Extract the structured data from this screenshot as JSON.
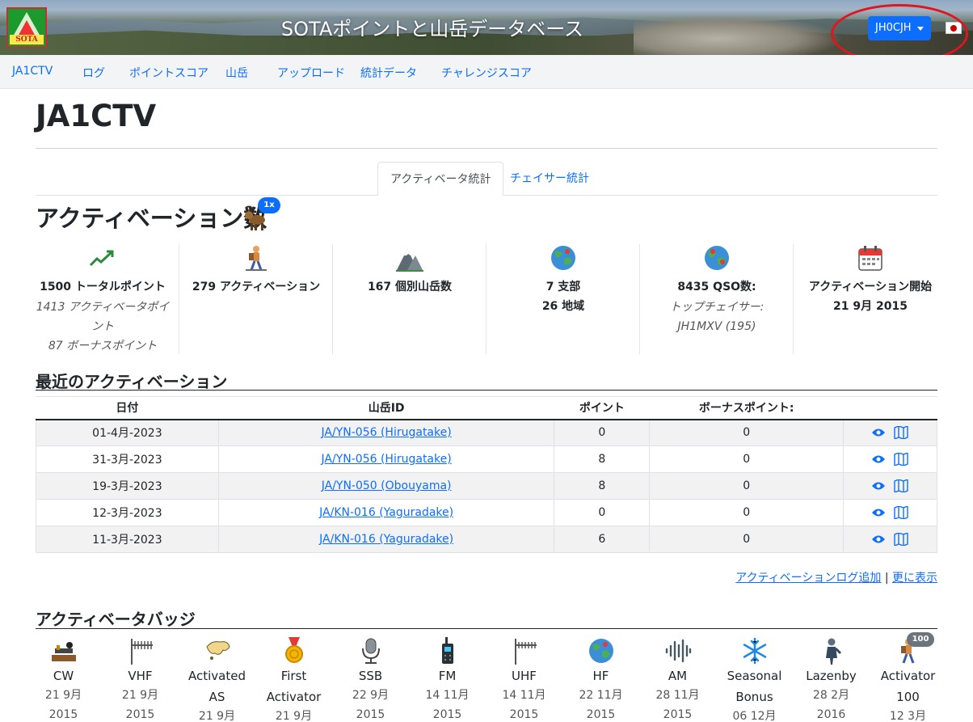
{
  "header": {
    "site_title": "SOTAポイントと山岳データベース",
    "logo_text": "SOTA",
    "user_button": "JH0CJH",
    "language_flag": "japan-flag-icon"
  },
  "nav": {
    "items": [
      "JA1CTV",
      "ログ",
      "ポイントスコア",
      "山岳",
      "アップロード",
      "統計データ",
      "チャレンジスコア"
    ]
  },
  "page": {
    "title": "JA1CTV"
  },
  "tabs": {
    "active": "アクティベータ統計",
    "other": "チェイサー統計"
  },
  "activations": {
    "heading": "アクティベーション数",
    "multiplier_badge": "1x",
    "stats": [
      {
        "icon": "trend-up-icon",
        "line1": "1500 トータルポイント",
        "line2": "1413 アクティベータポイント",
        "line3": "87 ボーナスポイント"
      },
      {
        "icon": "hiker-icon",
        "line1": "279 アクティベーション"
      },
      {
        "icon": "mountain-icon",
        "line1": "167 個別山岳数"
      },
      {
        "icon": "globe-icon",
        "line1": "7 支部",
        "line2": "26 地域"
      },
      {
        "icon": "globe-pin-icon",
        "line1": "8435 QSO数:",
        "line2": "トップチェイサー: JH1MXV (195)"
      },
      {
        "icon": "calendar-icon",
        "line1": "アクティベーション開始",
        "line2": "21 9月 2015"
      }
    ]
  },
  "recent": {
    "heading": "最近のアクティベーション",
    "columns": [
      "日付",
      "山岳ID",
      "ポイント",
      "ボーナスポイント:",
      ""
    ],
    "rows": [
      {
        "date": "01-4月-2023",
        "summit": "JA/YN-056 (Hirugatake)",
        "points": "0",
        "bonus": "0"
      },
      {
        "date": "31-3月-2023",
        "summit": "JA/YN-056 (Hirugatake)",
        "points": "8",
        "bonus": "0"
      },
      {
        "date": "19-3月-2023",
        "summit": "JA/YN-050 (Obouyama)",
        "points": "8",
        "bonus": "0"
      },
      {
        "date": "12-3月-2023",
        "summit": "JA/KN-016 (Yaguradake)",
        "points": "0",
        "bonus": "0"
      },
      {
        "date": "11-3月-2023",
        "summit": "JA/KN-016 (Yaguradake)",
        "points": "6",
        "bonus": "0"
      }
    ],
    "add_log_link": "アクティベーションログ追加",
    "separator": "|",
    "more_link": "更に表示"
  },
  "badges": {
    "heading": "アクティベータバッジ",
    "count_badge": "100",
    "items": [
      {
        "icon": "telegraph-key-icon",
        "name": "CW",
        "date1": "21 9月",
        "date2": "2015"
      },
      {
        "icon": "vhf-antenna-icon",
        "name": "VHF",
        "date1": "21 9月",
        "date2": "2015"
      },
      {
        "icon": "asia-map-icon",
        "name": "Activated",
        "name2": "AS",
        "date1": "21 9月"
      },
      {
        "icon": "medal-icon",
        "name": "First",
        "name2": "Activator",
        "date1": "21 9月"
      },
      {
        "icon": "microphone-icon",
        "name": "SSB",
        "date1": "22 9月",
        "date2": "2015"
      },
      {
        "icon": "walkie-talkie-icon",
        "name": "FM",
        "date1": "14 11月",
        "date2": "2015"
      },
      {
        "icon": "uhf-antenna-icon",
        "name": "UHF",
        "date1": "14 11月",
        "date2": "2015"
      },
      {
        "icon": "globe-icon",
        "name": "HF",
        "date1": "22 11月",
        "date2": "2015"
      },
      {
        "icon": "sound-wave-icon",
        "name": "AM",
        "date1": "28 11月",
        "date2": "2015"
      },
      {
        "icon": "snowflake-icon",
        "name": "Seasonal",
        "name2": "Bonus",
        "date1": "06 12月"
      },
      {
        "icon": "lazy-person-icon",
        "name": "Lazenby",
        "date1": "28 2月",
        "date2": "2016"
      },
      {
        "icon": "hiker-icon",
        "name": "Activator",
        "name2": "100",
        "date1": "12 3月"
      }
    ]
  }
}
